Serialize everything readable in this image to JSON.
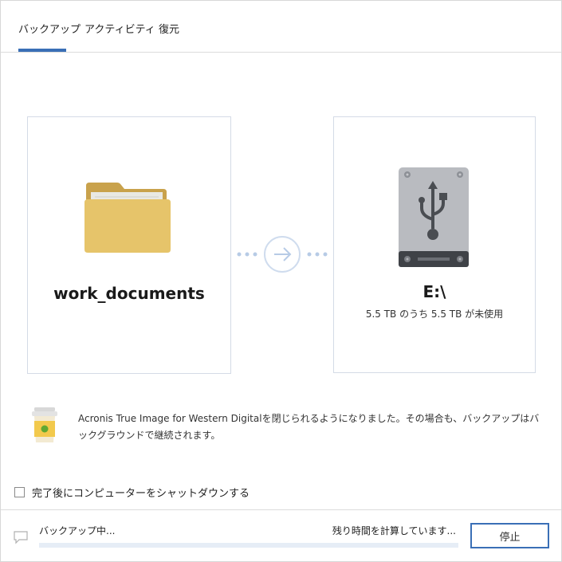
{
  "tabs": [
    {
      "label": "バックアップ",
      "active": true
    },
    {
      "label": "アクティビティ",
      "active": false
    },
    {
      "label": "復元",
      "active": false
    }
  ],
  "source": {
    "name": "work_documents",
    "icon": "folder-icon"
  },
  "destination": {
    "name": "E:\\",
    "info": "5.5 TB のうち 5.5 TB が未使用",
    "icon": "usb-drive-icon"
  },
  "message": {
    "icon": "coffee-cup-icon",
    "text": "Acronis True Image for Western Digitalを閉じられるようになりました。その場合も、バックアップはバックグラウンドで継続されます。"
  },
  "shutdown_option": {
    "label": "完了後にコンピューターをシャットダウンする",
    "checked": false
  },
  "footer": {
    "status": "バックアップ中...",
    "remaining": "残り時間を計算しています...",
    "stop_label": "停止",
    "progress": 0.0
  },
  "colors": {
    "accent": "#3a6fb6",
    "progress_track": "#e6edf6",
    "folder": "#e6c46a",
    "drive": "#b9bbc0"
  }
}
